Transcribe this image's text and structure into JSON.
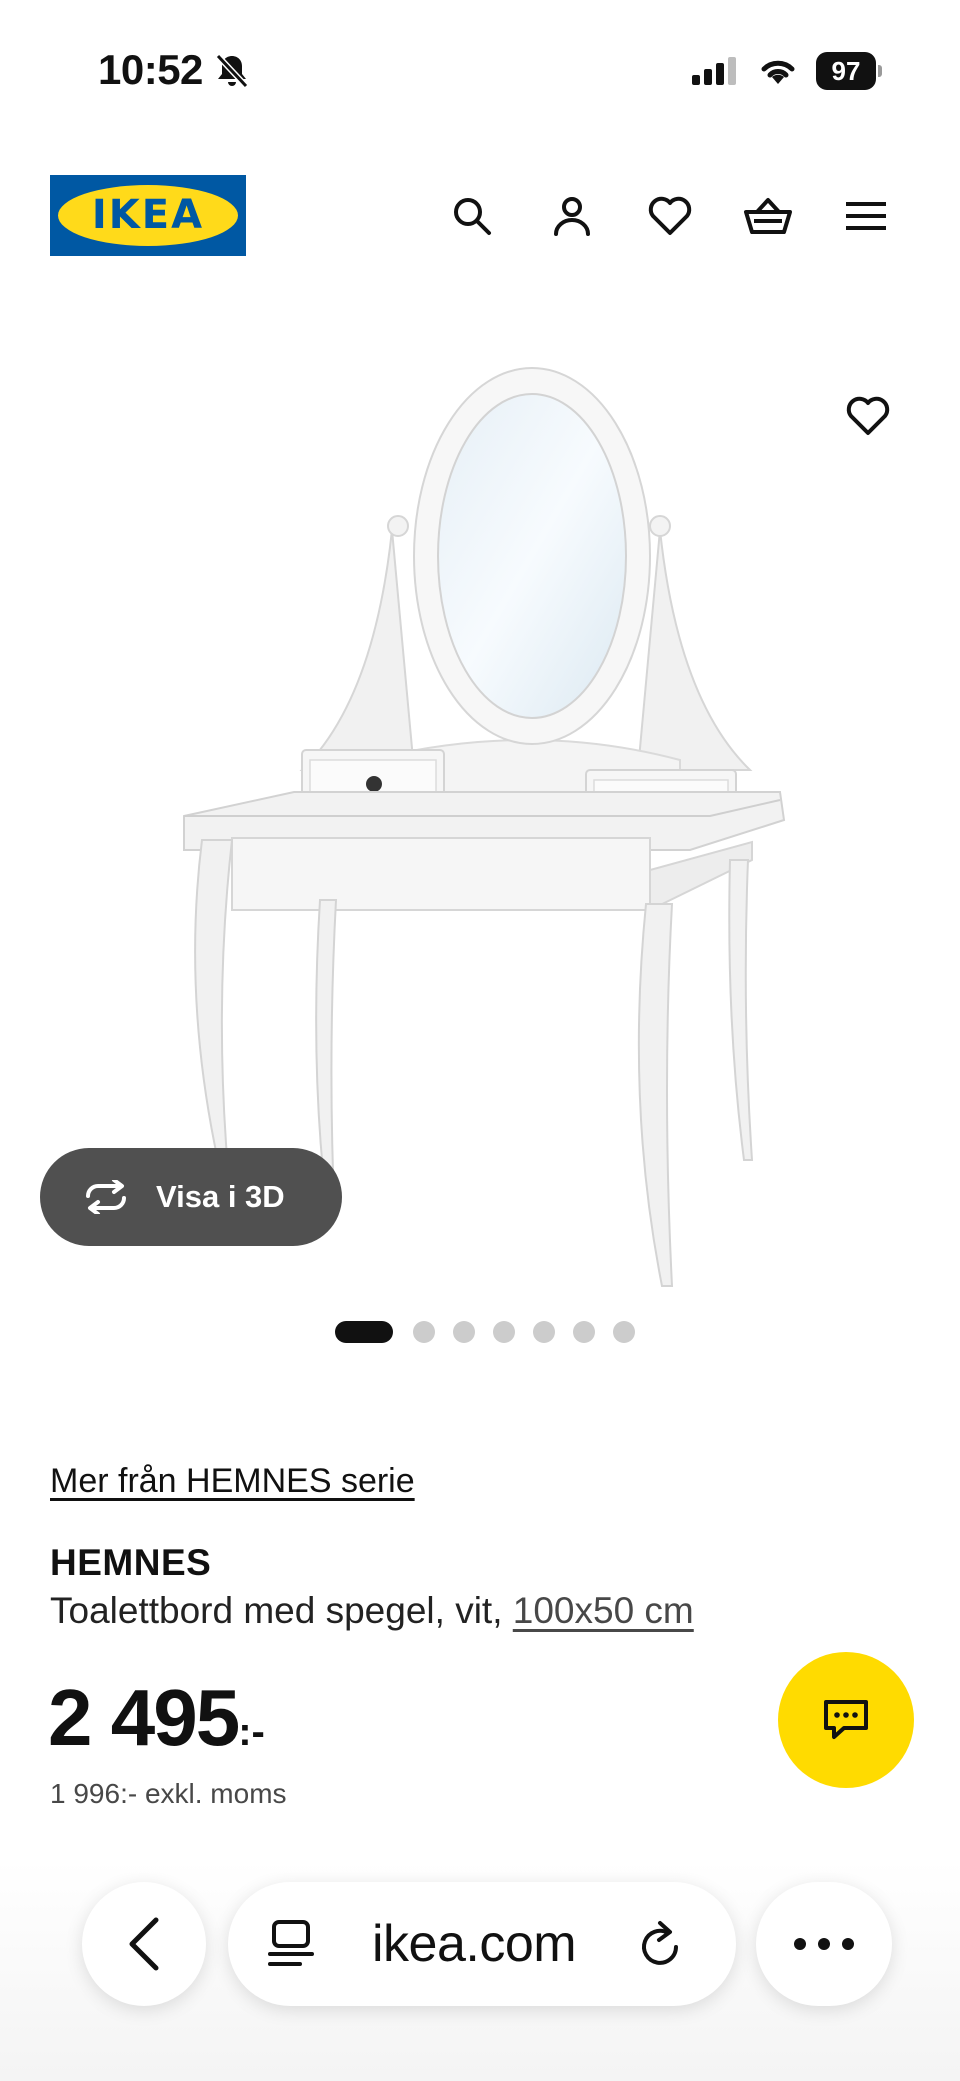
{
  "status_bar": {
    "time": "10:52",
    "battery": "97"
  },
  "header": {
    "logo_text": "IKEA",
    "icons": [
      "search-icon",
      "account-icon",
      "favourites-icon",
      "cart-icon",
      "menu-icon"
    ]
  },
  "gallery": {
    "view_3d_label": "Visa i 3D",
    "image_count": 7,
    "active_image": 1
  },
  "product": {
    "series_link": "Mer från HEMNES serie",
    "name": "HEMNES",
    "description": "Toalettbord med spegel, vit,",
    "size": "100x50 cm",
    "price": "2 495",
    "price_suffix": ":-",
    "price_excl_vat": "1 996:- exkl. moms"
  },
  "browser": {
    "url": "ikea.com"
  },
  "colors": {
    "ikea_blue": "#0058a3",
    "ikea_yellow": "#ffda1a",
    "chat_yellow": "#ffdb00",
    "view3d_bg": "#505050"
  }
}
